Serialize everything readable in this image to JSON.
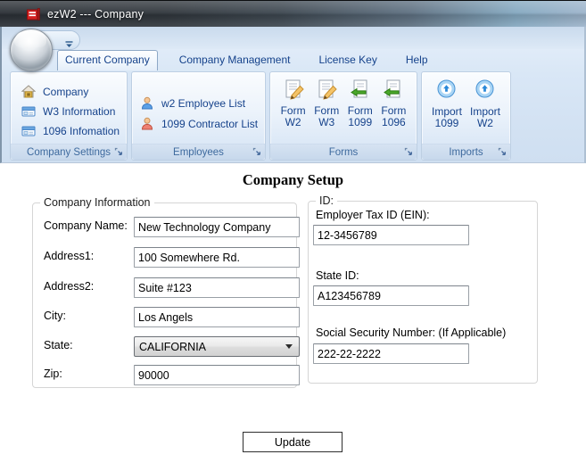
{
  "colors": {
    "ribbon_text": "#15428b",
    "group_footer_text": "#3e6a9e",
    "ribbon_bg": "#d8e6f5",
    "titlebar_dark": "#2b3036",
    "app_icon_red": "#d42020",
    "content_bg": "#ffffff"
  },
  "window": {
    "title": "ezW2 --- Company",
    "app_icon": "red-book-icon"
  },
  "qat": {
    "customize_icon": "chevron-down-icon"
  },
  "ribbon": {
    "tabs": [
      {
        "label": "Current Company",
        "active": true
      },
      {
        "label": "Company Management",
        "active": false
      },
      {
        "label": "License Key",
        "active": false
      },
      {
        "label": "Help",
        "active": false
      }
    ],
    "groups": [
      {
        "label": "Company Settings",
        "dialog_launcher_icon": "dialog-launcher-icon",
        "items": [
          {
            "label": "Company",
            "icon": "home-icon"
          },
          {
            "label": "W3 Information",
            "icon": "form-table-icon"
          },
          {
            "label": "1096 Infomation",
            "icon": "form-table-icon"
          }
        ]
      },
      {
        "label": "Employees",
        "dialog_launcher_icon": "dialog-launcher-icon",
        "items": [
          {
            "label": "w2 Employee List",
            "icon": "person-blue-icon"
          },
          {
            "label": "1099 Contractor List",
            "icon": "person-red-icon"
          }
        ]
      },
      {
        "label": "Forms",
        "dialog_launcher_icon": "dialog-launcher-icon",
        "items": [
          {
            "label_lines": [
              "Form",
              "W2"
            ],
            "icon": "document-edit-icon"
          },
          {
            "label_lines": [
              "Form",
              "W3"
            ],
            "icon": "document-edit-icon"
          },
          {
            "label_lines": [
              "Form",
              "1099"
            ],
            "icon": "document-export-icon"
          },
          {
            "label_lines": [
              "Form",
              "1096"
            ],
            "icon": "document-export-icon"
          }
        ]
      },
      {
        "label": "Imports",
        "dialog_launcher_icon": "dialog-launcher-icon",
        "items": [
          {
            "label_lines": [
              "Import",
              "1099"
            ],
            "icon": "import-circle-icon"
          },
          {
            "label_lines": [
              "Import",
              "W2"
            ],
            "icon": "import-circle-icon"
          }
        ]
      }
    ]
  },
  "content": {
    "heading": "Company Setup",
    "company_info": {
      "legend": "Company Information",
      "fields": [
        {
          "label": "Company Name:",
          "value": "New Technology Company",
          "control": "text"
        },
        {
          "label": "Address1:",
          "value": "100 Somewhere Rd.",
          "control": "text"
        },
        {
          "label": "Address2:",
          "value": "Suite #123",
          "control": "text"
        },
        {
          "label": "City:",
          "value": "Los Angels",
          "control": "text"
        },
        {
          "label": "State:",
          "value": "CALIFORNIA",
          "control": "dropdown"
        },
        {
          "label": "Zip:",
          "value": "90000",
          "control": "text"
        }
      ]
    },
    "id_section": {
      "legend": "ID:",
      "fields": [
        {
          "label": "Employer Tax ID (EIN):",
          "value": "12-3456789"
        },
        {
          "label": "State ID:",
          "value": "A123456789"
        },
        {
          "label": "Social Security Number: (If Applicable)",
          "value": "222-22-2222"
        }
      ]
    },
    "update_button": "Update"
  }
}
